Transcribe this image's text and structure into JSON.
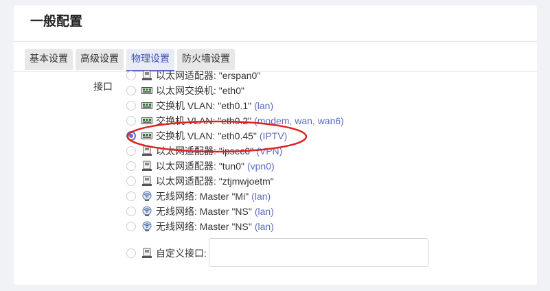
{
  "section": {
    "title": "一般配置"
  },
  "tabs": [
    {
      "label": "基本设置",
      "active": false
    },
    {
      "label": "高级设置",
      "active": false
    },
    {
      "label": "物理设置",
      "active": true
    },
    {
      "label": "防火墙设置",
      "active": false
    }
  ],
  "interface": {
    "label": "接口",
    "options": [
      {
        "text": "以太网适配器: \"erspan0\"",
        "zone": "",
        "icon": "ethernet-adapter-icon",
        "checked": false
      },
      {
        "text": "以太网交换机: \"eth0\"",
        "zone": "",
        "icon": "ethernet-switch-icon",
        "checked": false
      },
      {
        "text": "交换机 VLAN: \"eth0.1\"",
        "zone": "(lan)",
        "icon": "ethernet-switch-icon",
        "checked": false
      },
      {
        "text": "交换机 VLAN: \"eth0.2\"",
        "zone": "(modem, wan, wan6)",
        "icon": "ethernet-switch-icon",
        "checked": false
      },
      {
        "text": "交换机 VLAN: \"eth0.45\"",
        "zone": "(IPTV)",
        "icon": "ethernet-switch-icon",
        "checked": true
      },
      {
        "text": "以太网适配器: \"ipsec0\"",
        "zone": "(VPN)",
        "icon": "ethernet-adapter-icon",
        "checked": false
      },
      {
        "text": "以太网适配器: \"tun0\"",
        "zone": "(vpn0)",
        "icon": "ethernet-adapter-icon",
        "checked": false
      },
      {
        "text": "以太网适配器: \"ztjmwjoetm\"",
        "zone": "",
        "icon": "ethernet-adapter-icon",
        "checked": false
      },
      {
        "text": "无线网络: Master \"Mi\"",
        "zone": "(lan)",
        "icon": "wifi-icon",
        "checked": false
      },
      {
        "text": "无线网络: Master \"NS\"",
        "zone": "(lan)",
        "icon": "wifi-icon",
        "checked": false
      },
      {
        "text": "无线网络: Master \"NS\"",
        "zone": "(lan)",
        "icon": "wifi-icon",
        "checked": false
      }
    ],
    "custom": {
      "label": "自定义接口:",
      "value": ""
    }
  },
  "colors": {
    "accent": "#5b6bc0",
    "highlight_ring": "#e02020"
  }
}
